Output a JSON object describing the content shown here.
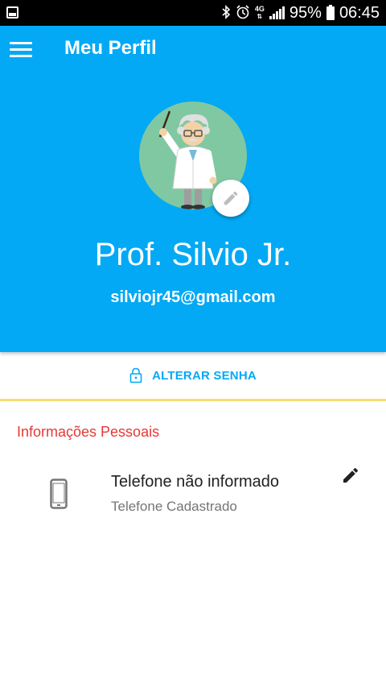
{
  "status_bar": {
    "battery": "95%",
    "time": "06:45",
    "network": "4G",
    "icons": [
      "screenshot-icon",
      "bluetooth-icon",
      "alarm-icon",
      "network-4g-icon",
      "signal-icon",
      "battery-icon"
    ]
  },
  "header": {
    "title": "Meu Perfil",
    "background_color": "#03a9f4"
  },
  "profile": {
    "name": "Prof. Silvio Jr.",
    "email": "silviojr45@gmail.com",
    "avatar": "professor-illustration"
  },
  "change_password": {
    "label": "ALTERAR SENHA",
    "icon": "lock-icon",
    "color": "#03a9f4"
  },
  "personal_info": {
    "title": "Informações Pessoais",
    "title_color": "#e53935",
    "phone": {
      "value": "Telefone não informado",
      "caption": "Telefone Cadastrado",
      "icon": "smartphone-icon",
      "edit_icon": "pencil-icon"
    }
  },
  "accent_divider_color": "#f7dd72"
}
